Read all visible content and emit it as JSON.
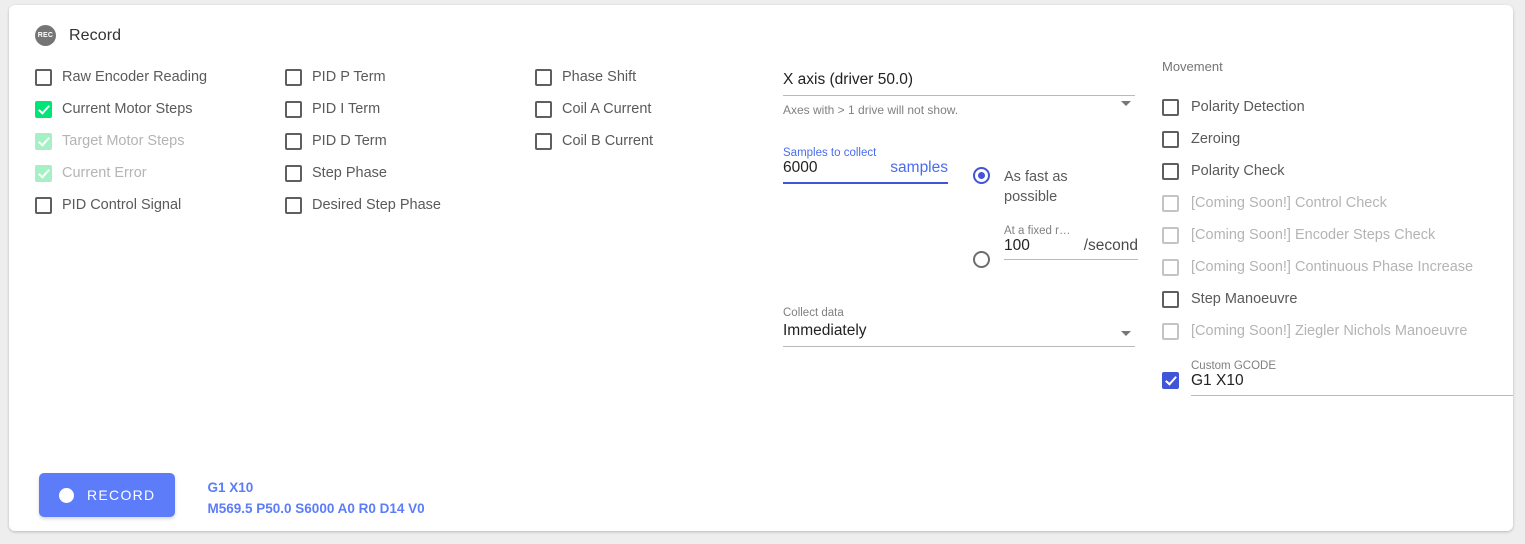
{
  "header": {
    "title": "Record",
    "icon": "rec-icon"
  },
  "signals": {
    "columns": [
      [
        {
          "label": "Raw Encoder Reading",
          "state": "off",
          "disabled": false
        },
        {
          "label": "Current Motor Steps",
          "state": "on",
          "disabled": false
        },
        {
          "label": "Target Motor Steps",
          "state": "on-light",
          "disabled": true
        },
        {
          "label": "Current Error",
          "state": "on-light",
          "disabled": true
        },
        {
          "label": "PID Control Signal",
          "state": "off",
          "disabled": false
        }
      ],
      [
        {
          "label": "PID P Term",
          "state": "off",
          "disabled": false
        },
        {
          "label": "PID I Term",
          "state": "off",
          "disabled": false
        },
        {
          "label": "PID D Term",
          "state": "off",
          "disabled": false
        },
        {
          "label": "Step Phase",
          "state": "off",
          "disabled": false
        },
        {
          "label": "Desired Step Phase",
          "state": "off",
          "disabled": false
        }
      ],
      [
        {
          "label": "Phase Shift",
          "state": "off",
          "disabled": false
        },
        {
          "label": "Coil A Current",
          "state": "off",
          "disabled": false
        },
        {
          "label": "Coil B Current",
          "state": "off",
          "disabled": false
        }
      ]
    ]
  },
  "axis": {
    "value": "X axis (driver 50.0)",
    "helper": "Axes with > 1 drive will not show."
  },
  "samples": {
    "label": "Samples to collect",
    "value": "6000",
    "suffix": "samples"
  },
  "rate": {
    "fast_label": "As fast as possible",
    "fixed_label": "At a fixed r…",
    "fixed_value": "100",
    "fixed_suffix": "/second",
    "selected": "fast"
  },
  "collect": {
    "label": "Collect data",
    "value": "Immediately"
  },
  "movement": {
    "title": "Movement",
    "items": [
      {
        "label": "Polarity Detection",
        "state": "off",
        "disabled": false
      },
      {
        "label": "Zeroing",
        "state": "off",
        "disabled": false
      },
      {
        "label": "Polarity Check",
        "state": "off",
        "disabled": false
      },
      {
        "label": "[Coming Soon!] Control Check",
        "state": "off",
        "disabled": true
      },
      {
        "label": "[Coming Soon!] Encoder Steps Check",
        "state": "off",
        "disabled": true
      },
      {
        "label": "[Coming Soon!] Continuous Phase Increase",
        "state": "off",
        "disabled": true
      },
      {
        "label": "Step Manoeuvre",
        "state": "off",
        "disabled": false
      },
      {
        "label": "[Coming Soon!] Ziegler Nichols Manoeuvre",
        "state": "off",
        "disabled": true
      }
    ],
    "gcode": {
      "label": "Custom GCODE",
      "value": "G1 X10",
      "checked": true
    }
  },
  "footer": {
    "record_label": "RECORD",
    "summary_line_1": "G1 X10",
    "summary_line_2": "M569.5 P50.0 S6000 A0 R0 D14 V0"
  },
  "colors": {
    "accent_blue": "#5c7cfa",
    "checkbox_green": "#00e676",
    "checkbox_green_light": "#a5f0c4",
    "checkbox_blue": "#4055d8",
    "text_gray": "#5a5a5a",
    "text_disabled": "#b4b4b4"
  }
}
